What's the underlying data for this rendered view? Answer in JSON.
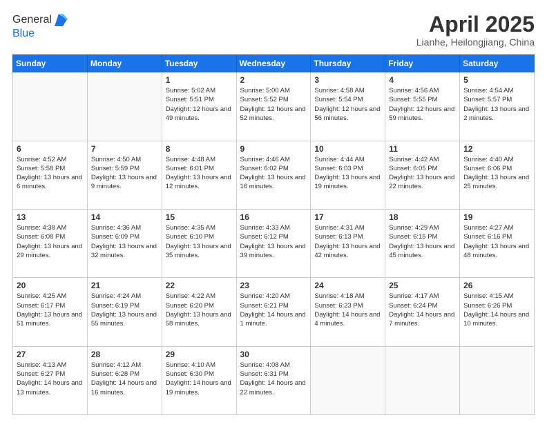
{
  "header": {
    "logo_line1": "General",
    "logo_line2": "Blue",
    "title": "April 2025",
    "location": "Lianhe, Heilongjiang, China"
  },
  "weekdays": [
    "Sunday",
    "Monday",
    "Tuesday",
    "Wednesday",
    "Thursday",
    "Friday",
    "Saturday"
  ],
  "weeks": [
    [
      {
        "day": "",
        "info": ""
      },
      {
        "day": "",
        "info": ""
      },
      {
        "day": "1",
        "info": "Sunrise: 5:02 AM\nSunset: 5:51 PM\nDaylight: 12 hours and 49 minutes."
      },
      {
        "day": "2",
        "info": "Sunrise: 5:00 AM\nSunset: 5:52 PM\nDaylight: 12 hours and 52 minutes."
      },
      {
        "day": "3",
        "info": "Sunrise: 4:58 AM\nSunset: 5:54 PM\nDaylight: 12 hours and 56 minutes."
      },
      {
        "day": "4",
        "info": "Sunrise: 4:56 AM\nSunset: 5:55 PM\nDaylight: 12 hours and 59 minutes."
      },
      {
        "day": "5",
        "info": "Sunrise: 4:54 AM\nSunset: 5:57 PM\nDaylight: 13 hours and 2 minutes."
      }
    ],
    [
      {
        "day": "6",
        "info": "Sunrise: 4:52 AM\nSunset: 5:58 PM\nDaylight: 13 hours and 6 minutes."
      },
      {
        "day": "7",
        "info": "Sunrise: 4:50 AM\nSunset: 5:59 PM\nDaylight: 13 hours and 9 minutes."
      },
      {
        "day": "8",
        "info": "Sunrise: 4:48 AM\nSunset: 6:01 PM\nDaylight: 13 hours and 12 minutes."
      },
      {
        "day": "9",
        "info": "Sunrise: 4:46 AM\nSunset: 6:02 PM\nDaylight: 13 hours and 16 minutes."
      },
      {
        "day": "10",
        "info": "Sunrise: 4:44 AM\nSunset: 6:03 PM\nDaylight: 13 hours and 19 minutes."
      },
      {
        "day": "11",
        "info": "Sunrise: 4:42 AM\nSunset: 6:05 PM\nDaylight: 13 hours and 22 minutes."
      },
      {
        "day": "12",
        "info": "Sunrise: 4:40 AM\nSunset: 6:06 PM\nDaylight: 13 hours and 25 minutes."
      }
    ],
    [
      {
        "day": "13",
        "info": "Sunrise: 4:38 AM\nSunset: 6:08 PM\nDaylight: 13 hours and 29 minutes."
      },
      {
        "day": "14",
        "info": "Sunrise: 4:36 AM\nSunset: 6:09 PM\nDaylight: 13 hours and 32 minutes."
      },
      {
        "day": "15",
        "info": "Sunrise: 4:35 AM\nSunset: 6:10 PM\nDaylight: 13 hours and 35 minutes."
      },
      {
        "day": "16",
        "info": "Sunrise: 4:33 AM\nSunset: 6:12 PM\nDaylight: 13 hours and 39 minutes."
      },
      {
        "day": "17",
        "info": "Sunrise: 4:31 AM\nSunset: 6:13 PM\nDaylight: 13 hours and 42 minutes."
      },
      {
        "day": "18",
        "info": "Sunrise: 4:29 AM\nSunset: 6:15 PM\nDaylight: 13 hours and 45 minutes."
      },
      {
        "day": "19",
        "info": "Sunrise: 4:27 AM\nSunset: 6:16 PM\nDaylight: 13 hours and 48 minutes."
      }
    ],
    [
      {
        "day": "20",
        "info": "Sunrise: 4:25 AM\nSunset: 6:17 PM\nDaylight: 13 hours and 51 minutes."
      },
      {
        "day": "21",
        "info": "Sunrise: 4:24 AM\nSunset: 6:19 PM\nDaylight: 13 hours and 55 minutes."
      },
      {
        "day": "22",
        "info": "Sunrise: 4:22 AM\nSunset: 6:20 PM\nDaylight: 13 hours and 58 minutes."
      },
      {
        "day": "23",
        "info": "Sunrise: 4:20 AM\nSunset: 6:21 PM\nDaylight: 14 hours and 1 minute."
      },
      {
        "day": "24",
        "info": "Sunrise: 4:18 AM\nSunset: 6:23 PM\nDaylight: 14 hours and 4 minutes."
      },
      {
        "day": "25",
        "info": "Sunrise: 4:17 AM\nSunset: 6:24 PM\nDaylight: 14 hours and 7 minutes."
      },
      {
        "day": "26",
        "info": "Sunrise: 4:15 AM\nSunset: 6:26 PM\nDaylight: 14 hours and 10 minutes."
      }
    ],
    [
      {
        "day": "27",
        "info": "Sunrise: 4:13 AM\nSunset: 6:27 PM\nDaylight: 14 hours and 13 minutes."
      },
      {
        "day": "28",
        "info": "Sunrise: 4:12 AM\nSunset: 6:28 PM\nDaylight: 14 hours and 16 minutes."
      },
      {
        "day": "29",
        "info": "Sunrise: 4:10 AM\nSunset: 6:30 PM\nDaylight: 14 hours and 19 minutes."
      },
      {
        "day": "30",
        "info": "Sunrise: 4:08 AM\nSunset: 6:31 PM\nDaylight: 14 hours and 22 minutes."
      },
      {
        "day": "",
        "info": ""
      },
      {
        "day": "",
        "info": ""
      },
      {
        "day": "",
        "info": ""
      }
    ]
  ]
}
